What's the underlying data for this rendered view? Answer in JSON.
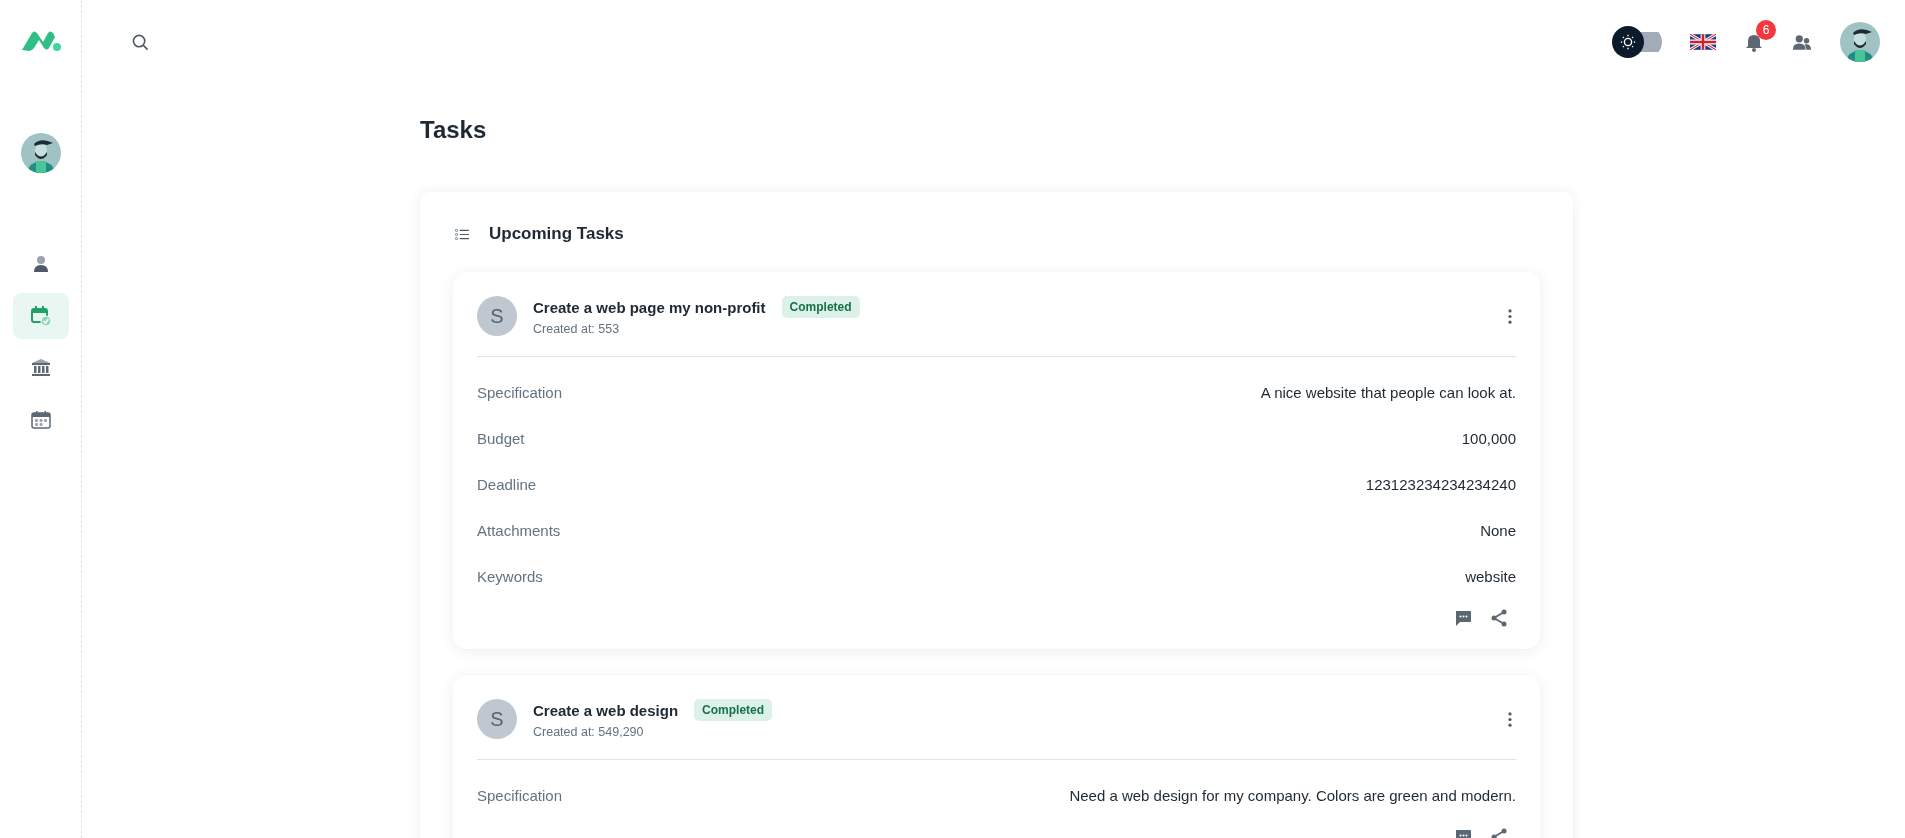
{
  "sidebar": {
    "items": [
      {
        "kind": "person",
        "selected": false
      },
      {
        "kind": "calendar-check",
        "selected": true
      },
      {
        "kind": "bank",
        "selected": false
      },
      {
        "kind": "calendar",
        "selected": false
      }
    ]
  },
  "header": {
    "theme_toggle": {
      "on": false
    },
    "notifications": {
      "count": "6"
    }
  },
  "page": {
    "title": "Tasks"
  },
  "panel": {
    "title": "Upcoming Tasks",
    "tasks": [
      {
        "avatar": "S",
        "title": "Create a web page my non-profit",
        "status": "Completed",
        "created": "Created at: 553",
        "fields": [
          {
            "label": "Specification",
            "value": "A nice website that people can look at."
          },
          {
            "label": "Budget",
            "value": "100,000"
          },
          {
            "label": "Deadline",
            "value": "123123234234234240"
          },
          {
            "label": "Attachments",
            "value": "None"
          },
          {
            "label": "Keywords",
            "value": "website"
          }
        ]
      },
      {
        "avatar": "S",
        "title": "Create a web design",
        "status": "Completed",
        "created": "Created at: 549,290",
        "fields": [
          {
            "label": "Specification",
            "value": "Need a web design for my company. Colors are green and modern."
          }
        ]
      }
    ]
  }
}
